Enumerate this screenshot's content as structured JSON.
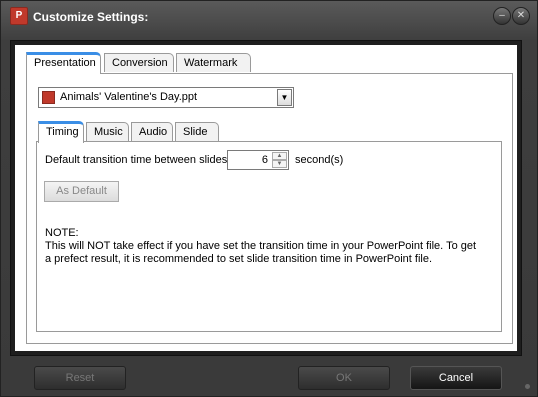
{
  "window": {
    "title": "Customize Settings:"
  },
  "outer_tabs": [
    {
      "label": "Presentation",
      "active": true
    },
    {
      "label": "Conversion",
      "active": false
    },
    {
      "label": "Watermark",
      "active": false
    }
  ],
  "file_select": {
    "value": "Animals' Valentine's Day.ppt"
  },
  "inner_tabs": [
    {
      "label": "Timing",
      "active": true
    },
    {
      "label": "Music",
      "active": false
    },
    {
      "label": "Audio",
      "active": false
    },
    {
      "label": "Slide",
      "active": false
    }
  ],
  "timing": {
    "transition_label": "Default transition time between slides:",
    "transition_value": "6",
    "unit_label": "second(s)",
    "as_default_label": "As Default"
  },
  "note": {
    "heading": "NOTE:",
    "body": "This will NOT take effect if you have set the transition time in your PowerPoint file. To get a prefect result, it is recommended to set slide transition time in PowerPoint file."
  },
  "footer": {
    "reset_label": "Reset",
    "ok_label": "OK",
    "cancel_label": "Cancel"
  }
}
